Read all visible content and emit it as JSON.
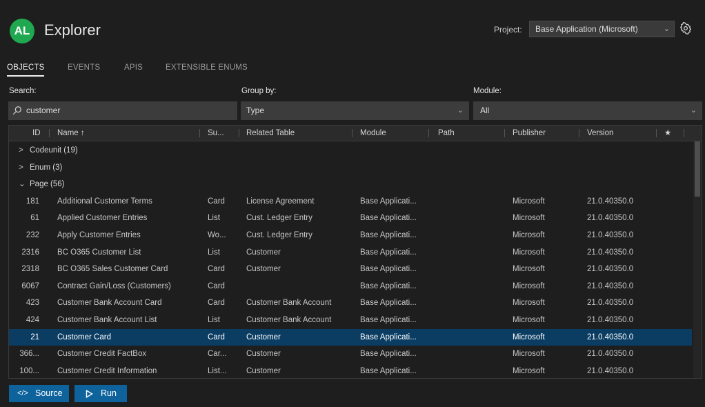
{
  "header": {
    "logo_text": "AL",
    "title": "Explorer",
    "project_label": "Project:",
    "project_value": "Base Application (Microsoft)"
  },
  "tabs": [
    {
      "label": "OBJECTS",
      "active": true
    },
    {
      "label": "EVENTS",
      "active": false
    },
    {
      "label": "APIS",
      "active": false
    },
    {
      "label": "EXTENSIBLE ENUMS",
      "active": false
    }
  ],
  "filters": {
    "search_label": "Search:",
    "search_value": "customer",
    "groupby_label": "Group by:",
    "groupby_value": "Type",
    "module_label": "Module:",
    "module_value": "All"
  },
  "columns": {
    "id": "ID",
    "name": "Name ↑",
    "subtype": "Su...",
    "related_table": "Related Table",
    "module": "Module",
    "path": "Path",
    "publisher": "Publisher",
    "version": "Version",
    "favorite": "★"
  },
  "groups": [
    {
      "label": "Codeunit (19)",
      "expanded": false
    },
    {
      "label": "Enum (3)",
      "expanded": false
    },
    {
      "label": "Page (56)",
      "expanded": true
    }
  ],
  "rows": [
    {
      "id": "181",
      "name": "Additional Customer Terms",
      "subtype": "Card",
      "table": "License Agreement",
      "module": "Base Applicati...",
      "publisher": "Microsoft",
      "version": "21.0.40350.0"
    },
    {
      "id": "61",
      "name": "Applied Customer Entries",
      "subtype": "List",
      "table": "Cust. Ledger Entry",
      "module": "Base Applicati...",
      "publisher": "Microsoft",
      "version": "21.0.40350.0"
    },
    {
      "id": "232",
      "name": "Apply Customer Entries",
      "subtype": "Wo...",
      "table": "Cust. Ledger Entry",
      "module": "Base Applicati...",
      "publisher": "Microsoft",
      "version": "21.0.40350.0"
    },
    {
      "id": "2316",
      "name": "BC O365 Customer List",
      "subtype": "List",
      "table": "Customer",
      "module": "Base Applicati...",
      "publisher": "Microsoft",
      "version": "21.0.40350.0"
    },
    {
      "id": "2318",
      "name": "BC O365 Sales Customer Card",
      "subtype": "Card",
      "table": "Customer",
      "module": "Base Applicati...",
      "publisher": "Microsoft",
      "version": "21.0.40350.0"
    },
    {
      "id": "6067",
      "name": "Contract Gain/Loss (Customers)",
      "subtype": "Card",
      "table": "",
      "module": "Base Applicati...",
      "publisher": "Microsoft",
      "version": "21.0.40350.0"
    },
    {
      "id": "423",
      "name": "Customer Bank Account Card",
      "subtype": "Card",
      "table": "Customer Bank Account",
      "module": "Base Applicati...",
      "publisher": "Microsoft",
      "version": "21.0.40350.0"
    },
    {
      "id": "424",
      "name": "Customer Bank Account List",
      "subtype": "List",
      "table": "Customer Bank Account",
      "module": "Base Applicati...",
      "publisher": "Microsoft",
      "version": "21.0.40350.0"
    },
    {
      "id": "21",
      "name": "Customer Card",
      "subtype": "Card",
      "table": "Customer",
      "module": "Base Applicati...",
      "publisher": "Microsoft",
      "version": "21.0.40350.0",
      "selected": true
    },
    {
      "id": "366...",
      "name": "Customer Credit FactBox",
      "subtype": "Car...",
      "table": "Customer",
      "module": "Base Applicati...",
      "publisher": "Microsoft",
      "version": "21.0.40350.0"
    },
    {
      "id": "100...",
      "name": "Customer Credit Information",
      "subtype": "List...",
      "table": "Customer",
      "module": "Base Applicati...",
      "publisher": "Microsoft",
      "version": "21.0.40350.0"
    }
  ],
  "buttons": {
    "source_label": "Source",
    "run_label": "Run"
  },
  "icons": {
    "search": "search-icon",
    "settings": "gear-icon",
    "dropdown": "chevron-down-icon",
    "source": "code-icon",
    "run": "play-icon"
  },
  "colors": {
    "background": "#1e1e1e",
    "accent": "#0e639c",
    "selected_row": "#0b3d63",
    "logo": "#1fa84f"
  }
}
